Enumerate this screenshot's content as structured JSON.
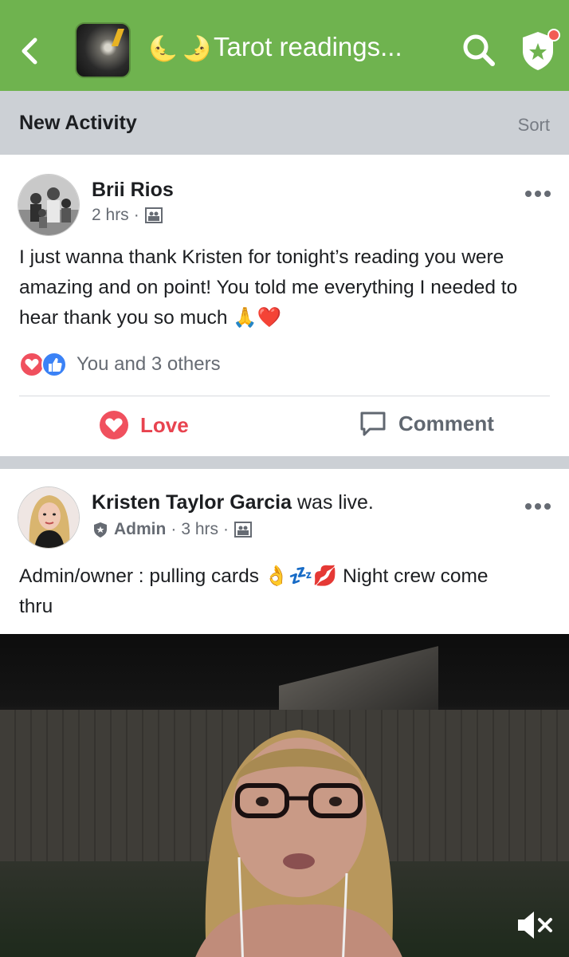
{
  "header": {
    "title": "Tarot readings...",
    "moons": [
      "🌜",
      "🌛"
    ],
    "accent": "#6fb34f"
  },
  "subbar": {
    "label": "New Activity",
    "sort": "Sort"
  },
  "posts": [
    {
      "author": "Brii Rios",
      "time": "2 hrs",
      "dot": "·",
      "text": "I just wanna thank Kristen for tonight’s reading you were amazing and on point! You told me everything I needed to hear thank you so much 🙏❤️",
      "reactions_text": "You and 3 others",
      "actions": {
        "love": "Love",
        "comment": "Comment"
      }
    },
    {
      "author": "Kristen Taylor Garcia",
      "verb": "was live.",
      "role": "Admin",
      "dot": "·",
      "time": "3 hrs",
      "text": "Admin/owner : pulling cards 👌💤💋 Night crew come thru"
    }
  ],
  "icons": {
    "back": "chevron-left-icon",
    "search": "search-icon",
    "shield": "shield-star-icon",
    "more": "more-horizontal-icon",
    "privacy": "group-members-icon",
    "love": "heart-icon",
    "like": "thumbs-up-icon",
    "comment": "comment-bubble-icon",
    "admin": "shield-badge-icon",
    "mute": "speaker-muted-icon"
  }
}
